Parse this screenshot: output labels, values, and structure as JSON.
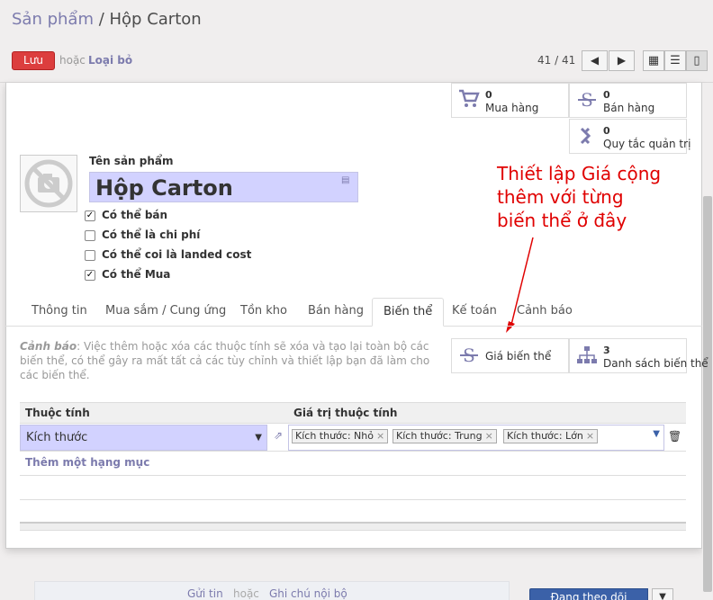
{
  "breadcrumb": {
    "parent": "Sản phẩm",
    "separator": " / ",
    "current": "Hộp Carton"
  },
  "toolbar": {
    "save_label": "Lưu",
    "or_label": "hoặc",
    "discard_label": "Loại bỏ"
  },
  "pager": {
    "value": "41 / 41"
  },
  "smart_buttons": {
    "purchases": {
      "count": "0",
      "label": "Mua hàng",
      "icon": "shopping-cart-icon"
    },
    "sales": {
      "count": "0",
      "label": "Bán hàng",
      "icon": "dollar-icon"
    },
    "reordering": {
      "count": "0",
      "label": "Quy tắc quản trị",
      "icon": "refresh-icon"
    },
    "variant_prices": {
      "label": "Giá biến thể",
      "icon": "dollar-icon"
    },
    "variants": {
      "count": "3",
      "label": "Danh sách biến thể",
      "icon": "sitemap-icon"
    }
  },
  "product": {
    "name_label": "Tên sản phẩm",
    "name": "Hộp Carton",
    "checkboxes": [
      {
        "label": "Có thể bán",
        "checked": true
      },
      {
        "label": "Có thể là chi phí",
        "checked": false
      },
      {
        "label": "Có thể coi là landed cost",
        "checked": false
      },
      {
        "label": "Có thể Mua",
        "checked": true
      }
    ]
  },
  "tabs": [
    "Thông tin",
    "Mua sắm / Cung ứng",
    "Tồn kho",
    "Bán hàng",
    "Biến thể",
    "Kế toán",
    "Cảnh báo"
  ],
  "active_tab": "Biến thể",
  "warning": {
    "prefix": "Cảnh báo",
    "text": ": Việc thêm hoặc xóa các thuộc tính sẽ xóa và tạo lại toàn bộ các biến thể, có thể gây ra mất tất cả các tùy chỉnh và thiết lập bạn đã làm cho các biến thể."
  },
  "table": {
    "headers": [
      "Thuộc tính",
      "Giá trị thuộc tính"
    ],
    "rows": [
      {
        "attribute": "Kích thước",
        "values": [
          "Kích thước: Nhỏ",
          "Kích thước: Trung",
          "Kích thước: Lớn"
        ]
      }
    ],
    "add_line": "Thêm một hạng mục"
  },
  "annotation": {
    "text": "Thiết lập Giá cộng thêm với từng biến thể ở đây",
    "lines": [
      "Thiết lập Giá cộng",
      "thêm với từng",
      "biến thể ở đây"
    ],
    "color": "#e00000"
  },
  "chatter": {
    "send_message": "Gửi tin",
    "or_label": "hoặc",
    "log_note": "Ghi chú nội bộ",
    "follow_label": "Đang theo dõi"
  },
  "colors": {
    "primary": "#7c7bad",
    "save": "#dc3e3e",
    "required_field": "#d2d2ff",
    "follow": "#3b61a8"
  }
}
